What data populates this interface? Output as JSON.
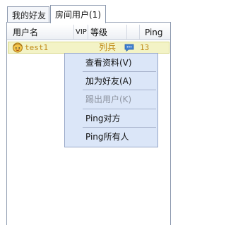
{
  "tabs": {
    "friends": "我的好友",
    "room_users": "房间用户(1)"
  },
  "columns": {
    "username": "用户名",
    "vip": "VIP",
    "level": "等级",
    "ping": "Ping"
  },
  "users": [
    {
      "name": "test1",
      "level": "列兵",
      "ping": "13"
    }
  ],
  "context_menu": {
    "view_profile": "查看资料(V)",
    "add_friend": "加为好友(A)",
    "kick_user": "踢出用户(K)",
    "ping_target": "Ping对方",
    "ping_all": "Ping所有人"
  },
  "colors": {
    "row_highlight": "#f3f3c6",
    "menu_background": "#dbe6f8",
    "user_text": "#c08a17"
  }
}
